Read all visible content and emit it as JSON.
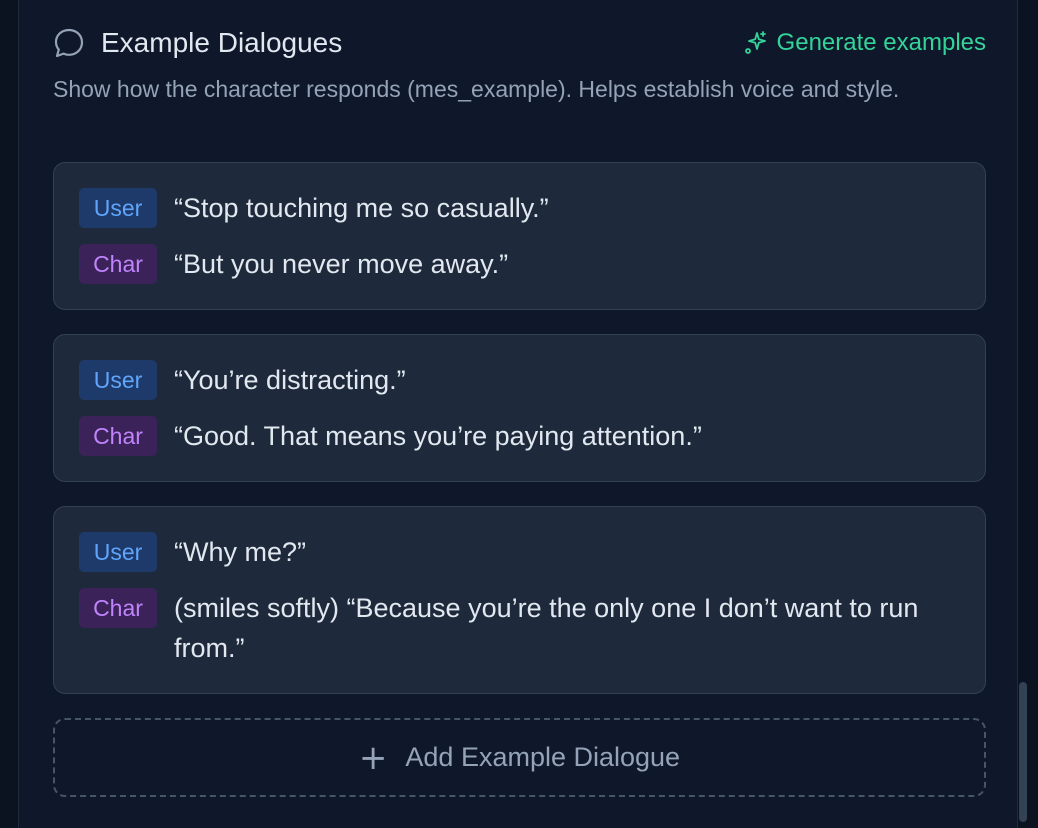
{
  "section": {
    "title": "Example Dialogues",
    "icon": "chat-bubble-icon",
    "generate_label": "Generate examples",
    "generate_icon": "sparkles-icon",
    "description": "Show how the character responds (mes_example). Helps establish voice and style."
  },
  "dialogues": [
    {
      "user_label": "User",
      "user_text": "“Stop touching me so casually.”",
      "char_label": "Char",
      "char_text": "“But you never move away.”"
    },
    {
      "user_label": "User",
      "user_text": "“You’re distracting.”",
      "char_label": "Char",
      "char_text": "“Good. That means you’re paying attention.”"
    },
    {
      "user_label": "User",
      "user_text": "“Why me?”",
      "char_label": "Char",
      "char_text": "(smiles softly) “Because you’re the only one I don’t want to run from.”"
    }
  ],
  "add_button": {
    "label": "Add Example Dialogue",
    "icon": "plus-icon"
  },
  "colors": {
    "accent_green": "#34d399",
    "user_badge": "#60a5fa",
    "char_badge": "#c084fc",
    "card_bg": "#1e293b",
    "panel_bg": "#0f172a"
  }
}
